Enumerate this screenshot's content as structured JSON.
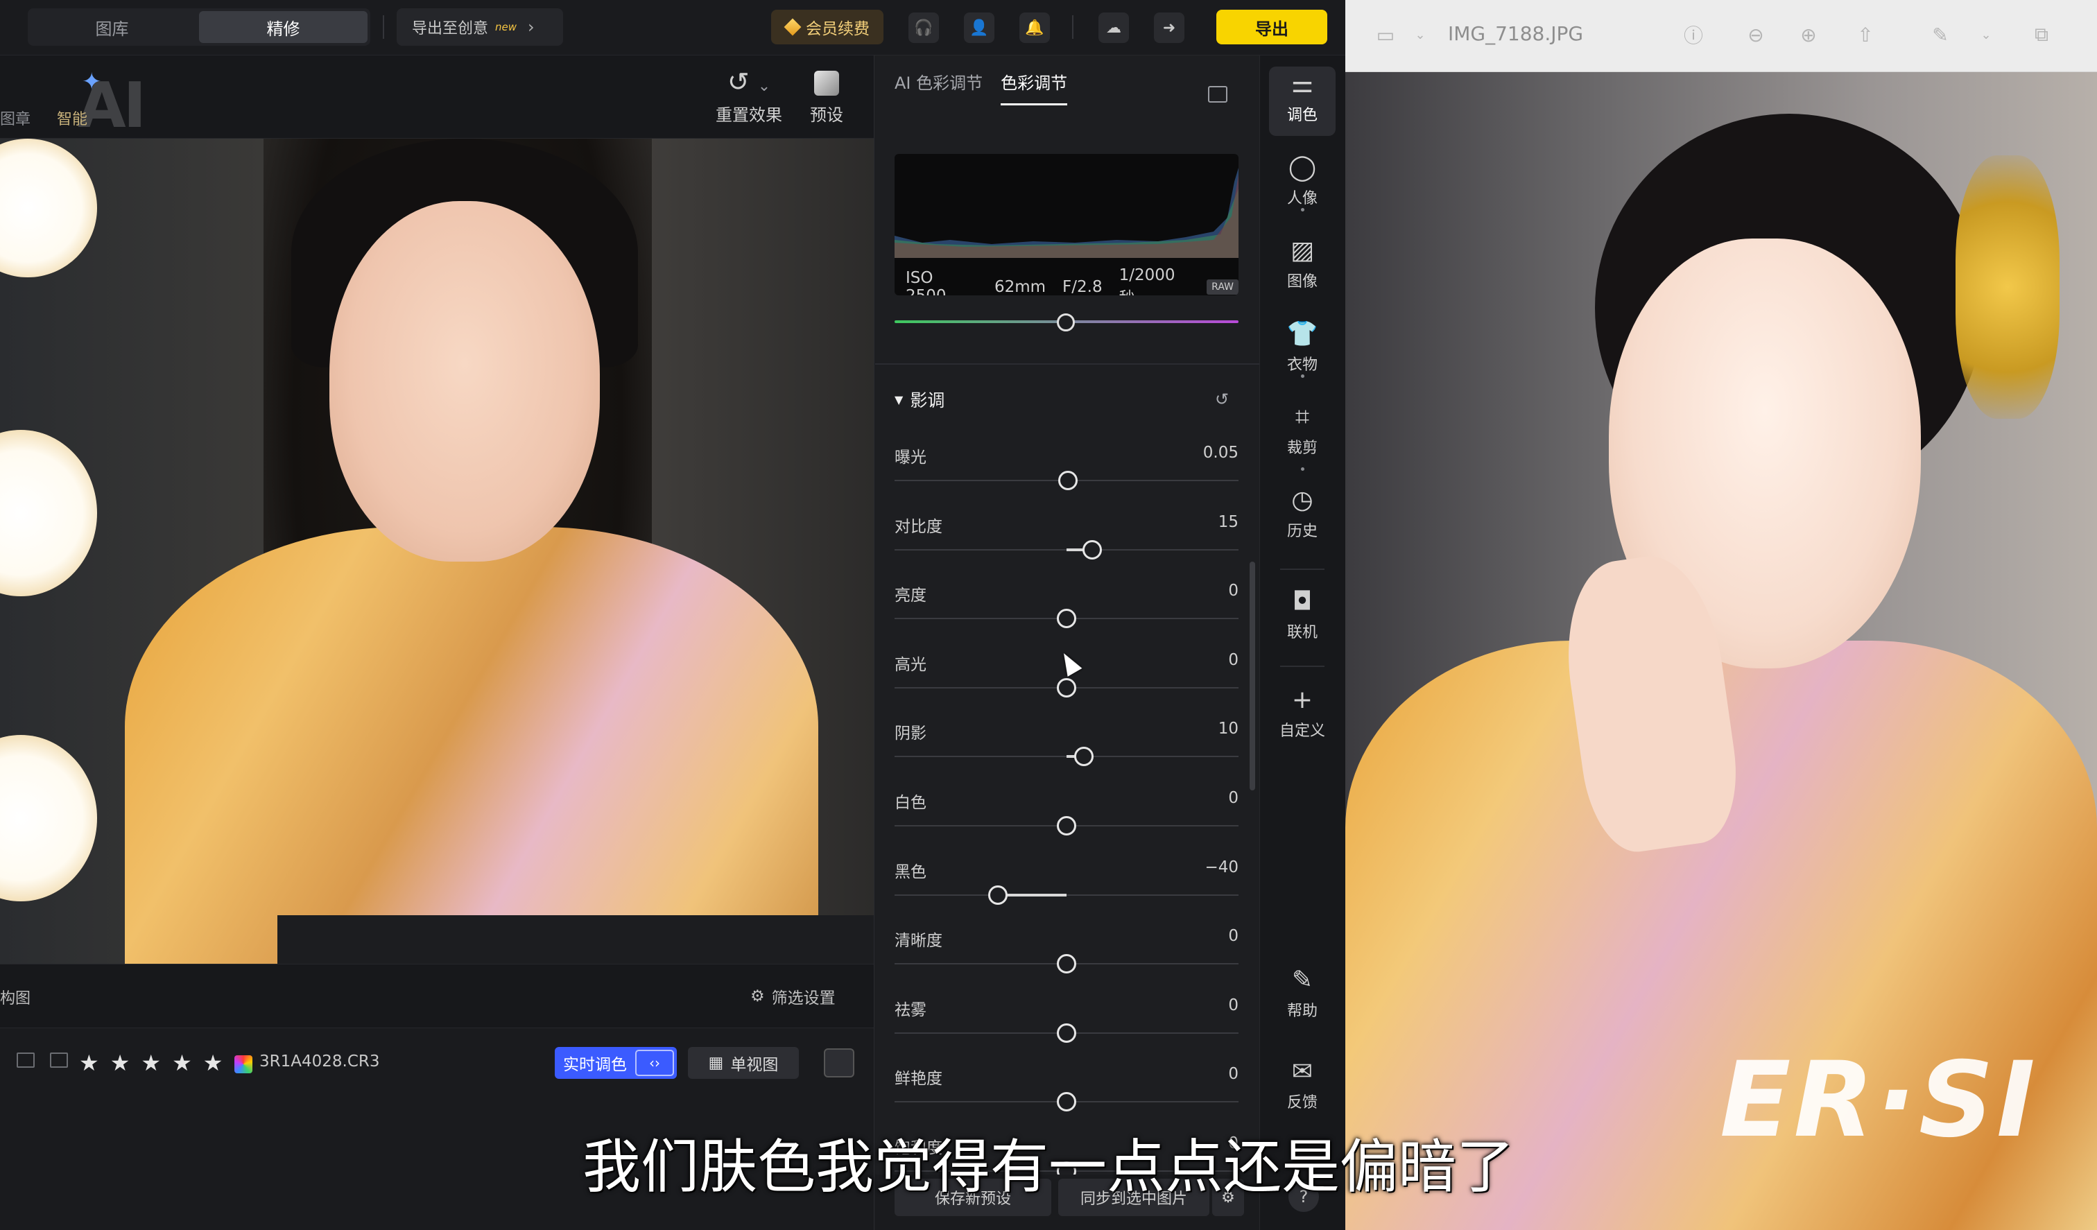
{
  "topbar": {
    "tabs": [
      {
        "label": "图库",
        "active": false
      },
      {
        "label": "精修",
        "active": true
      }
    ],
    "export_to_create": "导出至创意",
    "new_badge": "new",
    "vip": "会员续费",
    "export": "导出"
  },
  "tools": {
    "seal_label": "图章",
    "smart_label": "智能",
    "ai_text": "AI",
    "reset_effects": "重置效果",
    "preset": "预设"
  },
  "panel": {
    "tabs": [
      {
        "label": "AI 色彩调节",
        "active": false
      },
      {
        "label": "色彩调节",
        "active": true
      }
    ],
    "exif": {
      "iso": "ISO 2500",
      "focal": "62mm",
      "aperture": "F/2.8",
      "shutter": "1/2000秒",
      "raw": "RAW"
    },
    "section_title": "影调",
    "sliders": [
      {
        "label": "曝光",
        "value": "0.05",
        "level": 0.505
      },
      {
        "label": "对比度",
        "value": "15",
        "level": 0.575
      },
      {
        "label": "亮度",
        "value": "0",
        "level": 0.5
      },
      {
        "label": "高光",
        "value": "0",
        "level": 0.5
      },
      {
        "label": "阴影",
        "value": "10",
        "level": 0.55
      },
      {
        "label": "白色",
        "value": "0",
        "level": 0.5
      },
      {
        "label": "黑色",
        "value": "−40",
        "level": 0.3
      },
      {
        "label": "清晰度",
        "value": "0",
        "level": 0.5
      },
      {
        "label": "祛雾",
        "value": "0",
        "level": 0.5
      },
      {
        "label": "鲜艳度",
        "value": "0",
        "level": 0.5
      },
      {
        "label": "饱和度",
        "value": "0",
        "level": 0.5
      }
    ],
    "save_preset": "保存新预设",
    "sync_selected": "同步到选中图片"
  },
  "nav": [
    {
      "label": "调色",
      "icon": "sliders-icon",
      "active": true
    },
    {
      "label": "人像",
      "icon": "face-icon",
      "active": false
    },
    {
      "label": "图像",
      "icon": "image-icon",
      "active": false
    },
    {
      "label": "衣物",
      "icon": "shirt-icon",
      "active": false
    },
    {
      "label": "裁剪",
      "icon": "crop-icon",
      "active": false
    },
    {
      "label": "历史",
      "icon": "clock-icon",
      "active": false
    },
    {
      "label": "联机",
      "icon": "camera-link-icon",
      "active": false
    },
    {
      "label": "自定义",
      "icon": "plus-icon",
      "active": false
    },
    {
      "label": "帮助",
      "icon": "help-doc-icon",
      "active": false
    },
    {
      "label": "反馈",
      "icon": "mail-icon",
      "active": false
    }
  ],
  "bottom": {
    "compose": "构图",
    "filter_settings": "筛选设置",
    "filename": "3R1A4028.CR3",
    "stars": [
      "★",
      "★",
      "★",
      "★",
      "★"
    ],
    "realtime": "实时调色",
    "single_view": "单视图"
  },
  "preview": {
    "title": "IMG_7188.JPG",
    "watermark": "ER·SI"
  },
  "subtitle": "我们肤色我觉得有一点点还是偏暗了",
  "colors": {
    "accent_yellow": "#f8d400",
    "accent_blue": "#3b5bff",
    "panel_bg": "#1d1e21"
  }
}
